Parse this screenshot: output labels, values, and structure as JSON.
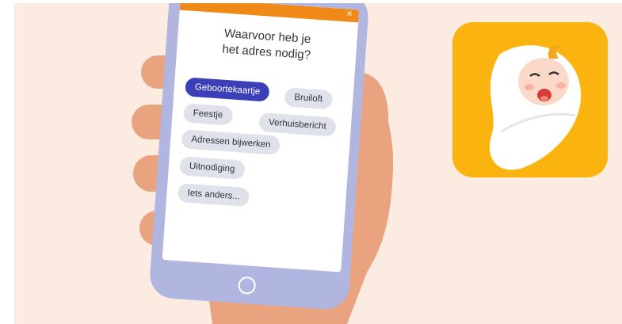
{
  "app": {
    "question_line1": "Waarvoor heb je",
    "question_line2": "het adres nodig?",
    "options": [
      {
        "label": "Geboortekaartje",
        "selected": true
      },
      {
        "label": "Bruiloft",
        "selected": false
      },
      {
        "label": "Feestje",
        "selected": false
      },
      {
        "label": "Verhuisbericht",
        "selected": false
      },
      {
        "label": "Adressen bijwerken",
        "selected": false
      },
      {
        "label": "Uitnodiging",
        "selected": false
      },
      {
        "label": "Iets anders...",
        "selected": false
      }
    ],
    "close_icon": "close-icon"
  },
  "colors": {
    "background": "#fcebe1",
    "accent_orange": "#ef8a19",
    "selected_chip": "#3c40b8",
    "chip": "#dfe2ea",
    "phone_frame": "#b0b6df",
    "skin": "#e9a47f",
    "app_icon_bg": "#fbb40f"
  }
}
